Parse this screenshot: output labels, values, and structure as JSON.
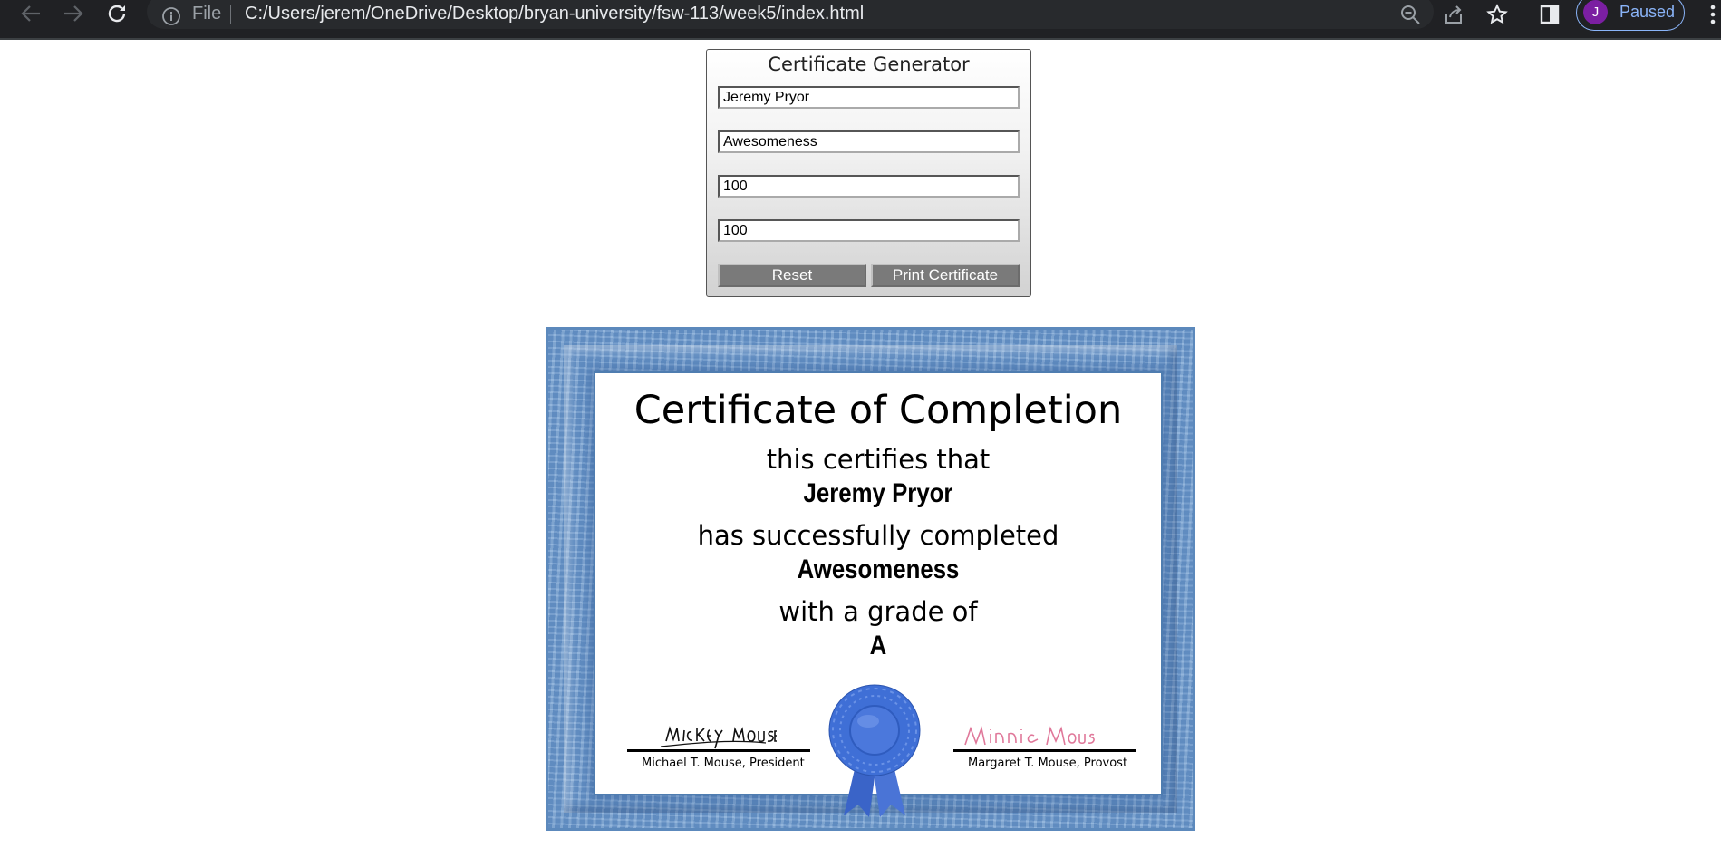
{
  "browser": {
    "file_label": "File",
    "url": "C:/Users/jerem/OneDrive/Desktop/bryan-university/fsw-113/week5/index.html",
    "profile_initial": "J",
    "profile_status": "Paused"
  },
  "generator": {
    "title": "Certificate Generator",
    "fields": {
      "name": "Jeremy Pryor",
      "course": "Awesomeness",
      "score1": "100",
      "score2": "100"
    },
    "reset_label": "Reset",
    "print_label": "Print Certificate"
  },
  "certificate": {
    "title": "Certificate of Completion",
    "line1": "this certifies that",
    "name": "Jeremy Pryor",
    "line2": "has successfully completed",
    "course": "Awesomeness",
    "line3": "with a grade of",
    "grade": "A",
    "signatures": {
      "left_signature": "Mickey Mouse",
      "left_caption": "Michael T. Mouse, President",
      "right_signature": "Minnie Mouse",
      "right_caption": "Margaret T. Mouse, Provost"
    },
    "colors": {
      "frame": "#6f9ccf",
      "ribbon": "#3f6fd6",
      "right_signature_ink": "#e0789a"
    }
  }
}
